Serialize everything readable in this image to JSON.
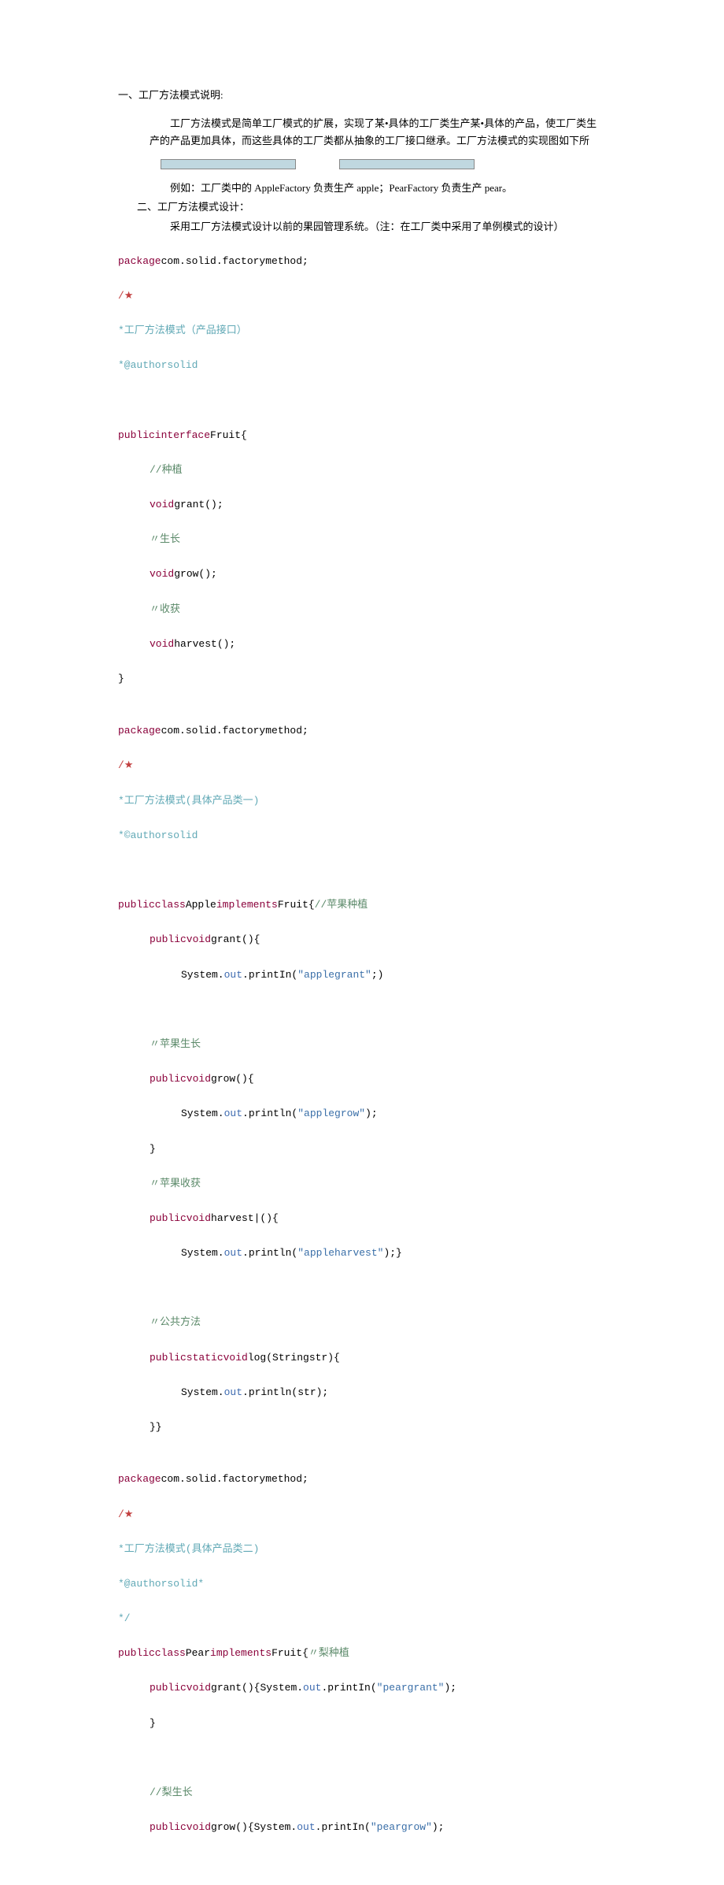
{
  "heading1": "一、工厂方法模式说明:",
  "para1": "工厂方法模式是简单工厂模式的扩展，实现了某•具体的工厂类生产某•具体的产品，使工厂类生产的产品更加具体，而这些具体的工厂类都从抽象的工厂接口继承。工厂方法模式的实现图如下所",
  "afterBox": "例如：工厂类中的 AppleFactory 负责生产 apple；PearFactory 负责生产 pear。",
  "heading2": "二、工厂方法模式设计：",
  "para2": "采用工厂方法模式设计以前的果园管理系统。（注：在工厂类中采用了单例模式的设计）",
  "code1": {
    "l1a": "package",
    "l1b": "com.solid.factorymethod;",
    "l2": "/★",
    "l3": "*工厂方法模式（产品接口）",
    "l4": "*@authorsolid",
    "l5a": "publicinterface",
    "l5b": "Fruit{",
    "c1": "//种植",
    "m1a": "void",
    "m1b": "grant();",
    "c2": "〃生长",
    "m2a": "void",
    "m2b": "grow();",
    "c3": "〃收获",
    "m3a": "void",
    "m3b": "harvest();",
    "close": "}"
  },
  "code2": {
    "l1a": "package",
    "l1b": "com.solid.factorymethod;",
    "l2": "/★",
    "l3": "*工厂方法模式(具体产品类一)",
    "l4": "*©authorsolid",
    "cla": "publicclass",
    "clb": "Apple",
    "clc": "implements",
    "cld": "Fruit{",
    "cmt1": "//苹果种植",
    "g1a": "publicvoid",
    "g1b": "grant(){",
    "g1c": "System.",
    "g1d": "out",
    "g1e": ".printIn(",
    "g1f": "\"applegrant\"",
    "g1g": ";)",
    "cmt2": "〃苹果生长",
    "g2a": "publicvoid",
    "g2b": "grow(){",
    "g2c": "System.",
    "g2d": "out",
    "g2e": ".println(",
    "g2f": "\"applegrow\"",
    "g2g": ");",
    "close1": "}",
    "cmt3": "〃苹果收获",
    "g3a": "publicvoid",
    "g3b": "harvest|(){",
    "g3c": "System.",
    "g3d": "out",
    "g3e": ".println(",
    "g3f": "\"appleharvest\"",
    "g3g": ");}",
    "cmt4": "〃公共方法",
    "g4a": "publicstaticvoid",
    "g4b": "log(Stringstr){",
    "g4c": "System.",
    "g4d": "out",
    "g4e": ".println(str);",
    "close2": "}}"
  },
  "code3": {
    "l1a": "package",
    "l1b": "com.solid.factorymethod;",
    "l2": "/★",
    "l3": "*工厂方法模式(具体产品类二)",
    "l4a": "*@authorsolid*",
    "l4b": "*/",
    "cla": "publicclass",
    "clb": "Pear",
    "clc": "implements",
    "cld": "Fruit{",
    "cmt1": "〃梨种植",
    "g1a": "publicvoid",
    "g1b": "grant(){",
    "g1c": "System.",
    "g1d": "out",
    "g1e": ".printIn(",
    "g1f": "\"peargrant\"",
    "g1g": ");",
    "close1": "}",
    "cmt2": "//梨生长",
    "g2a": "publicvoid",
    "g2b": "grow(){",
    "g2c": "System.",
    "g2d": "out",
    "g2e": ".printIn(",
    "g2f": "\"peargrow\"",
    "g2g": ");"
  }
}
